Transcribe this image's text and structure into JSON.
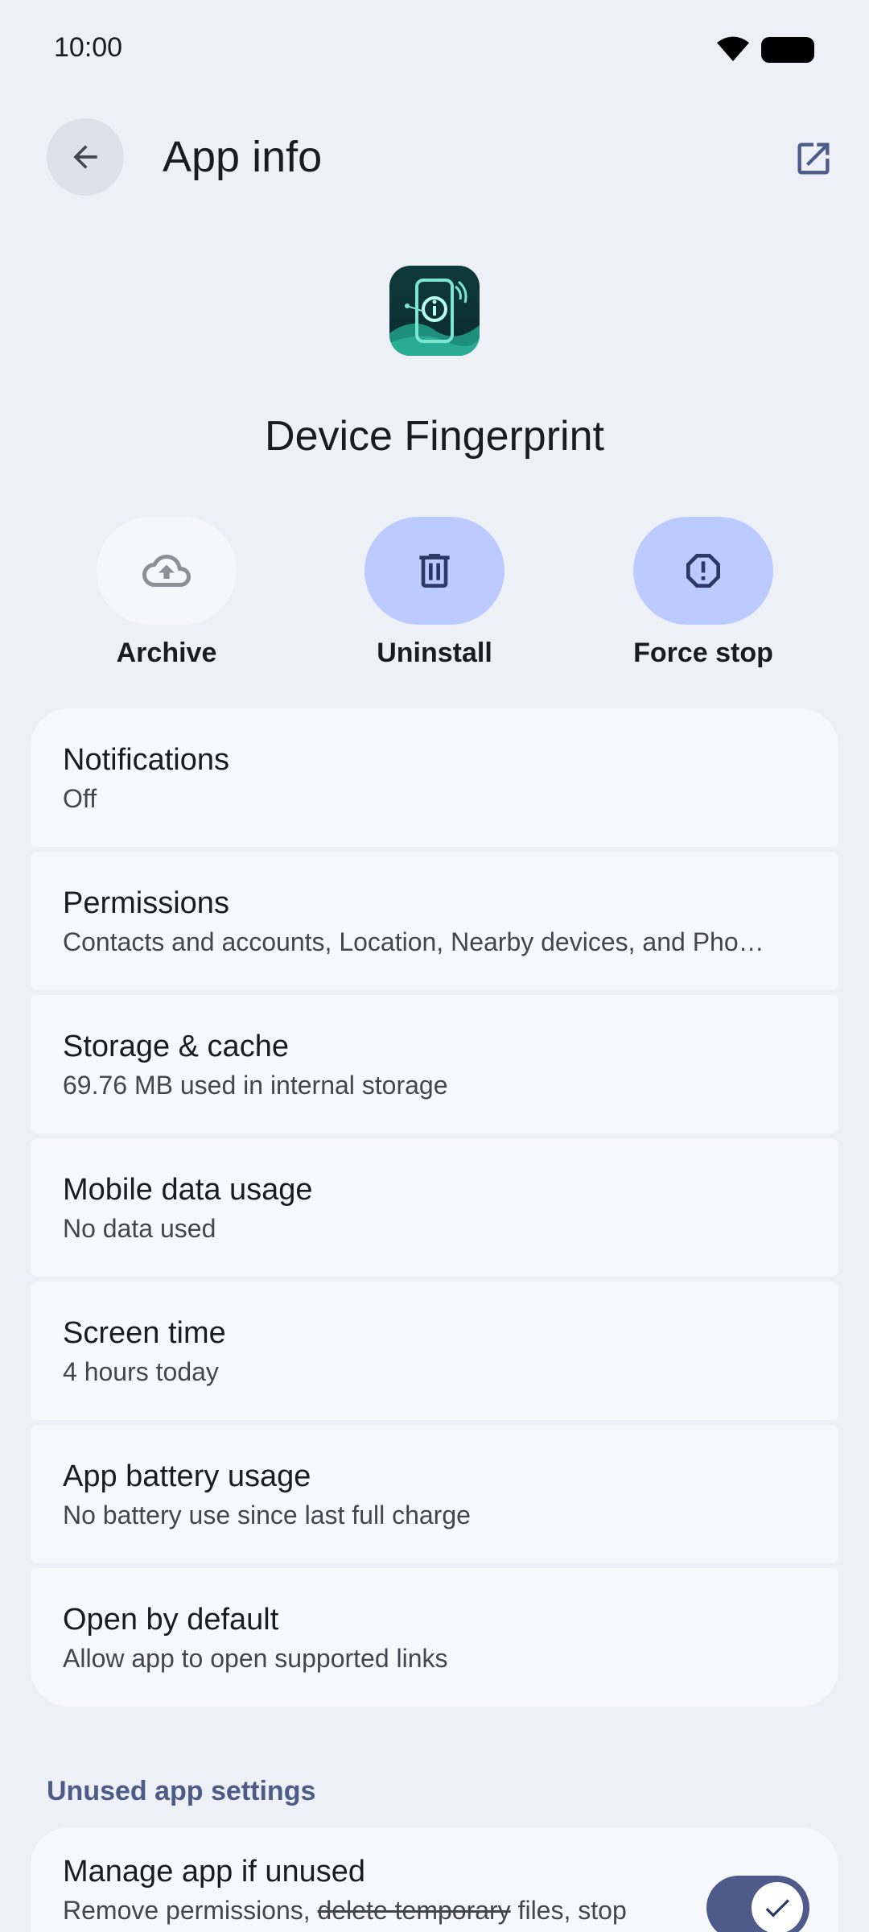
{
  "status_bar": {
    "time": "10:00"
  },
  "header": {
    "title": "App info"
  },
  "app": {
    "name": "Device Fingerprint"
  },
  "actions": [
    {
      "label": "Archive",
      "icon": "cloud-upload-icon"
    },
    {
      "label": "Uninstall",
      "icon": "trash-icon"
    },
    {
      "label": "Force stop",
      "icon": "alert-octagon-icon"
    }
  ],
  "settings": [
    {
      "title": "Notifications",
      "subtitle": "Off"
    },
    {
      "title": "Permissions",
      "subtitle": "Contacts and accounts, Location, Nearby devices, and Pho…"
    },
    {
      "title": "Storage & cache",
      "subtitle": "69.76 MB used in internal storage"
    },
    {
      "title": "Mobile data usage",
      "subtitle": "No data used"
    },
    {
      "title": "Screen time",
      "subtitle": "4 hours today"
    },
    {
      "title": "App battery usage",
      "subtitle": "No battery use since last full charge"
    },
    {
      "title": "Open by default",
      "subtitle": "Allow app to open supported links"
    }
  ],
  "unused_section": {
    "header": "Unused app settings",
    "title": "Manage app if unused",
    "subtitle_part1": "Remove permissions, ",
    "subtitle_strike": "delete temporary",
    "subtitle_part2": " files, stop",
    "toggle_on": true
  },
  "colors": {
    "background": "#eef0f7",
    "accent": "#bccbff",
    "toggle": "#4d5a8a",
    "section_header": "#4c5b88"
  }
}
